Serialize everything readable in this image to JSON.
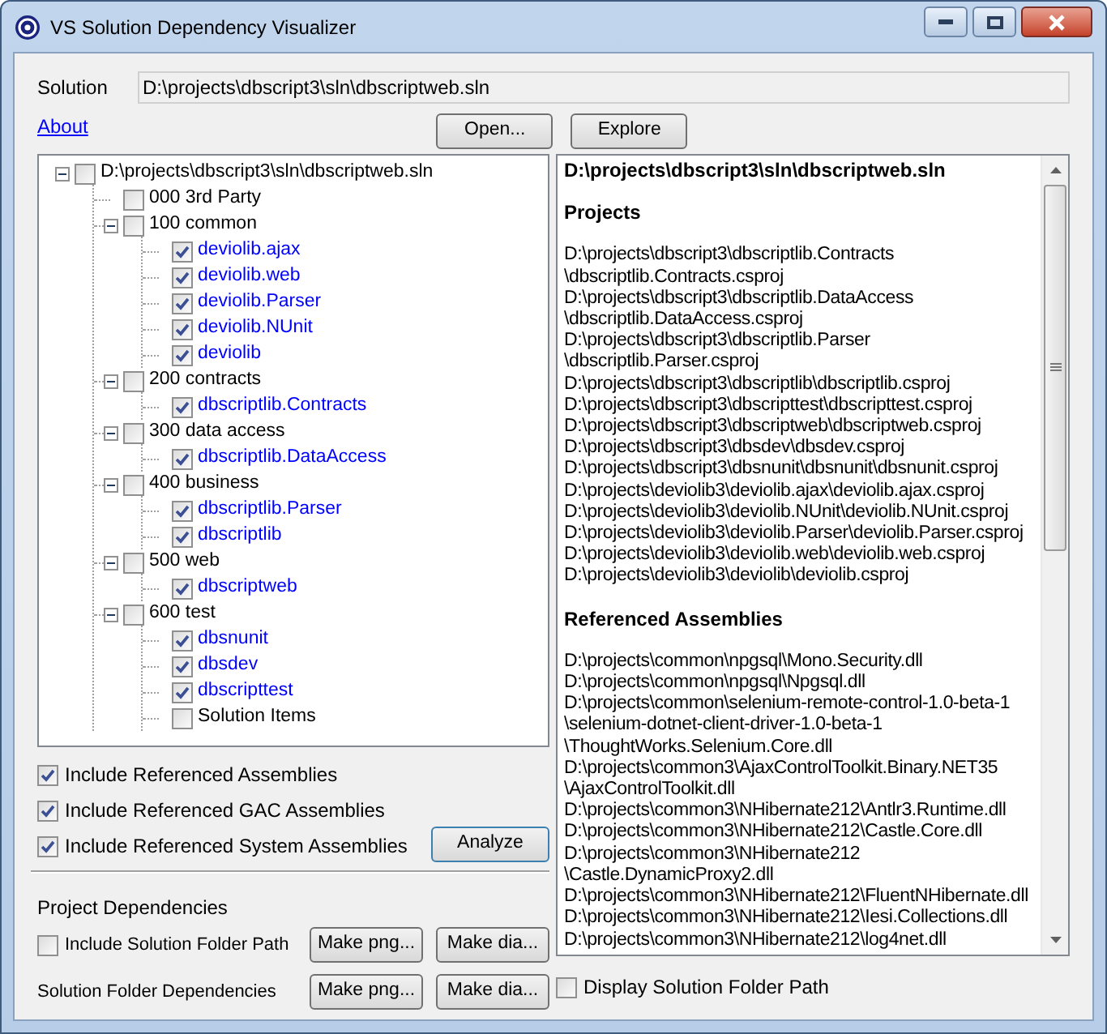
{
  "window": {
    "title": "VS Solution Dependency Visualizer"
  },
  "solution": {
    "label": "Solution",
    "value": "D:\\projects\\dbscript3\\sln\\dbscriptweb.sln"
  },
  "about_link": "About",
  "top_buttons": [
    "Open...",
    "Explore"
  ],
  "tree": {
    "label": "D:\\projects\\dbscript3\\sln\\dbscriptweb.sln",
    "checked": false,
    "expanded": true,
    "children": [
      {
        "label": "000 3rd Party",
        "kind": "folder",
        "checked": false
      },
      {
        "label": "100 common",
        "kind": "folder",
        "checked": false,
        "expanded": true,
        "children": [
          {
            "label": "deviolib.ajax",
            "kind": "project",
            "checked": true
          },
          {
            "label": "deviolib.web",
            "kind": "project",
            "checked": true
          },
          {
            "label": "deviolib.Parser",
            "kind": "project",
            "checked": true
          },
          {
            "label": "deviolib.NUnit",
            "kind": "project",
            "checked": true
          },
          {
            "label": "deviolib",
            "kind": "project",
            "checked": true
          }
        ]
      },
      {
        "label": "200 contracts",
        "kind": "folder",
        "checked": false,
        "expanded": true,
        "children": [
          {
            "label": "dbscriptlib.Contracts",
            "kind": "project",
            "checked": true
          }
        ]
      },
      {
        "label": "300 data access",
        "kind": "folder",
        "checked": false,
        "expanded": true,
        "children": [
          {
            "label": "dbscriptlib.DataAccess",
            "kind": "project",
            "checked": true
          }
        ]
      },
      {
        "label": "400 business",
        "kind": "folder",
        "checked": false,
        "expanded": true,
        "children": [
          {
            "label": "dbscriptlib.Parser",
            "kind": "project",
            "checked": true
          },
          {
            "label": "dbscriptlib",
            "kind": "project",
            "checked": true
          }
        ]
      },
      {
        "label": "500 web",
        "kind": "folder",
        "checked": false,
        "expanded": true,
        "children": [
          {
            "label": "dbscriptweb",
            "kind": "project",
            "checked": true
          }
        ]
      },
      {
        "label": "600 test",
        "kind": "folder",
        "checked": false,
        "expanded": true,
        "children": [
          {
            "label": "dbsnunit",
            "kind": "project",
            "checked": true
          },
          {
            "label": "dbsdev",
            "kind": "project",
            "checked": true
          },
          {
            "label": "dbscripttest",
            "kind": "project",
            "checked": true
          },
          {
            "label": "Solution Items",
            "kind": "folder",
            "checked": false
          }
        ]
      }
    ]
  },
  "options": [
    {
      "label": "Include Referenced Assemblies",
      "checked": true
    },
    {
      "label": "Include Referenced GAC Assemblies",
      "checked": true
    },
    {
      "label": "Include Referenced System Assemblies",
      "checked": true
    }
  ],
  "analyze_button": "Analyze",
  "project_dependencies": {
    "label": "Project Dependencies",
    "option": {
      "label": "Include Solution Folder Path",
      "checked": false
    },
    "buttons": [
      "Make png...",
      "Make dia..."
    ]
  },
  "solution_folder_dependencies": {
    "label": "Solution Folder Dependencies",
    "buttons": [
      "Make png...",
      "Make dia..."
    ],
    "option": {
      "label": "Display Solution Folder Path",
      "checked": false
    }
  },
  "report": {
    "title": "D:\\projects\\dbscript3\\sln\\dbscriptweb.sln",
    "sections": [
      {
        "heading": "Projects",
        "lines": [
          "D:\\projects\\dbscript3\\dbscriptlib.Contracts",
          "\\dbscriptlib.Contracts.csproj",
          "D:\\projects\\dbscript3\\dbscriptlib.DataAccess",
          "\\dbscriptlib.DataAccess.csproj",
          "D:\\projects\\dbscript3\\dbscriptlib.Parser",
          "\\dbscriptlib.Parser.csproj",
          "D:\\projects\\dbscript3\\dbscriptlib\\dbscriptlib.csproj",
          "D:\\projects\\dbscript3\\dbscripttest\\dbscripttest.csproj",
          "D:\\projects\\dbscript3\\dbscriptweb\\dbscriptweb.csproj",
          "D:\\projects\\dbscript3\\dbsdev\\dbsdev.csproj",
          "D:\\projects\\dbscript3\\dbsnunit\\dbsnunit\\dbsnunit.csproj",
          "D:\\projects\\deviolib3\\deviolib.ajax\\deviolib.ajax.csproj",
          "D:\\projects\\deviolib3\\deviolib.NUnit\\deviolib.NUnit.csproj",
          "D:\\projects\\deviolib3\\deviolib.Parser\\deviolib.Parser.csproj",
          "D:\\projects\\deviolib3\\deviolib.web\\deviolib.web.csproj",
          "D:\\projects\\deviolib3\\deviolib\\deviolib.csproj"
        ]
      },
      {
        "heading": "Referenced Assemblies",
        "lines": [
          "D:\\projects\\common\\npgsql\\Mono.Security.dll",
          "D:\\projects\\common\\npgsql\\Npgsql.dll",
          "D:\\projects\\common\\selenium-remote-control-1.0-beta-1",
          "\\selenium-dotnet-client-driver-1.0-beta-1",
          "\\ThoughtWorks.Selenium.Core.dll",
          "D:\\projects\\common3\\AjaxControlToolkit.Binary.NET35",
          "\\AjaxControlToolkit.dll",
          "D:\\projects\\common3\\NHibernate212\\Antlr3.Runtime.dll",
          "D:\\projects\\common3\\NHibernate212\\Castle.Core.dll",
          "D:\\projects\\common3\\NHibernate212",
          "\\Castle.DynamicProxy2.dll",
          "D:\\projects\\common3\\NHibernate212\\FluentNHibernate.dll",
          "D:\\projects\\common3\\NHibernate212\\Iesi.Collections.dll",
          "D:\\projects\\common3\\NHibernate212\\log4net.dll"
        ]
      }
    ]
  }
}
